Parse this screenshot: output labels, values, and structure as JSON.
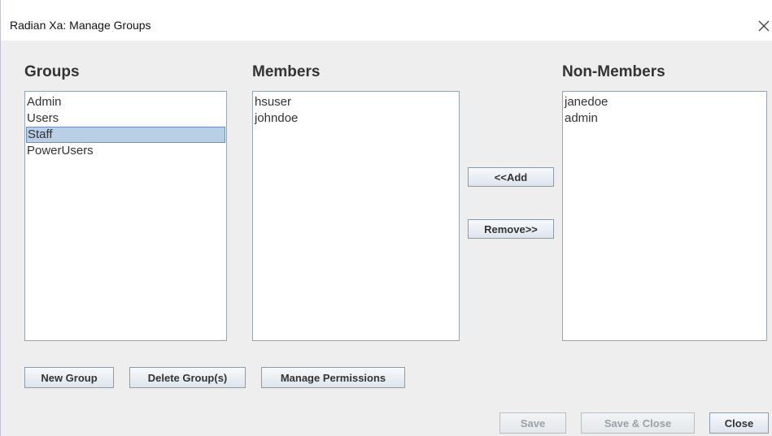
{
  "window": {
    "title": "Radian Xa: Manage Groups"
  },
  "groups": {
    "header": "Groups",
    "items": [
      "Admin",
      "Users",
      "Staff",
      "PowerUsers"
    ],
    "selected": "Staff"
  },
  "members": {
    "header": "Members",
    "items": [
      "hsuser",
      "johndoe"
    ]
  },
  "non_members": {
    "header": "Non-Members",
    "items": [
      "janedoe",
      "admin"
    ]
  },
  "transfer": {
    "add_label": "<<Add",
    "remove_label": "Remove>>"
  },
  "group_actions": {
    "new_group": "New Group",
    "delete_groups": "Delete Group(s)",
    "manage_permissions": "Manage Permissions"
  },
  "footer": {
    "save": "Save",
    "save_close": "Save & Close",
    "close": "Close"
  },
  "colors": {
    "selection": "#b8cfe5",
    "background": "#eeeeee"
  }
}
